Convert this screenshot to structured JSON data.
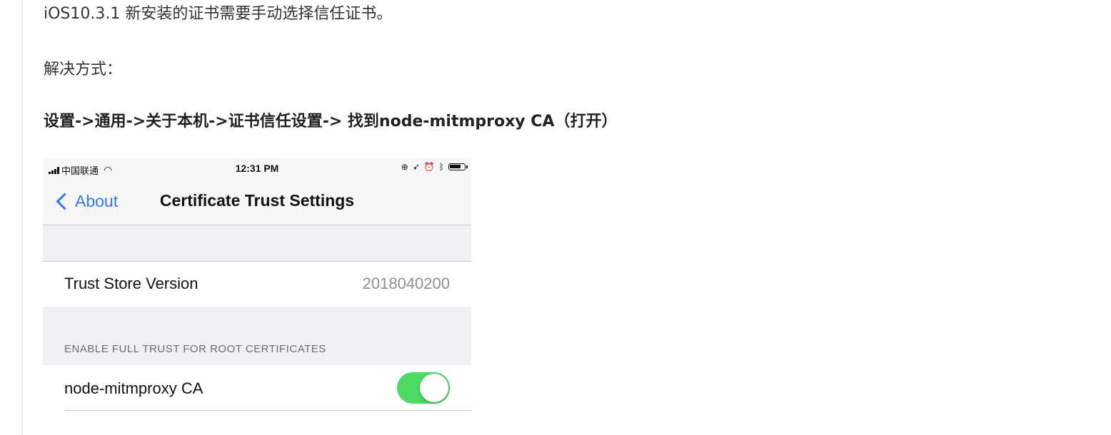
{
  "article": {
    "line1": "iOS10.3.1 新安装的证书需要手动选择信任证书。",
    "line2": "解决方式：",
    "line3": "设置->通用->关于本机->证书信任设置-> 找到node-mitmproxy CA（打开）"
  },
  "screenshot": {
    "status_bar": {
      "carrier": "中国联通",
      "time": "12:31 PM",
      "icons": [
        "signal-icon",
        "wifi-icon",
        "lock-rotation-icon",
        "location-icon",
        "alarm-icon",
        "bluetooth-icon",
        "battery-icon"
      ]
    },
    "nav": {
      "back_label": "About",
      "title": "Certificate Trust Settings"
    },
    "trust_store": {
      "label": "Trust Store Version",
      "value": "2018040200"
    },
    "section_header": "ENABLE FULL TRUST FOR ROOT CERTIFICATES",
    "certificate": {
      "label": "node-mitmproxy CA",
      "enabled": true
    },
    "colors": {
      "accent": "#3478f6",
      "toggle_on": "#4cd964",
      "grouped_background": "#efeff4"
    }
  }
}
